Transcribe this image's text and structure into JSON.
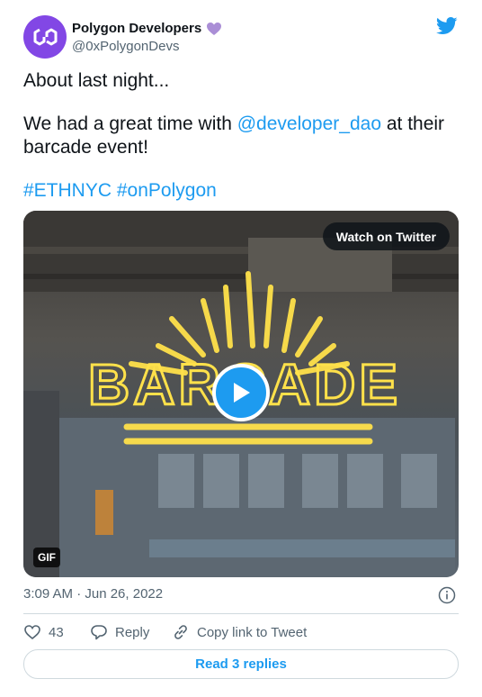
{
  "author": {
    "display_name": "Polygon Developers",
    "handle": "@0xPolygonDevs",
    "avatar_icon": "polygon-logo-icon",
    "badge_icon": "purple-heart-icon"
  },
  "tweet": {
    "line1": "About last night...",
    "line2_before": "We had a great time with ",
    "mention": "@developer_dao",
    "line2_after": " at their barcade event!",
    "hashtag1": "#ETHNYC",
    "hashtag2": "#onPolygon"
  },
  "media": {
    "watch_label": "Watch on Twitter",
    "gif_label": "GIF",
    "sign_text": "BARCADE"
  },
  "timestamp": "3:09 AM · Jun 26, 2022",
  "actions": {
    "like_count": "43",
    "reply_label": "Reply",
    "copy_label": "Copy link to Tweet"
  },
  "read_replies_label": "Read 3 replies",
  "colors": {
    "polygon_purple": "#8247e5",
    "twitter_blue": "#1d9bf0",
    "neon_yellow": "#ffe14a"
  }
}
